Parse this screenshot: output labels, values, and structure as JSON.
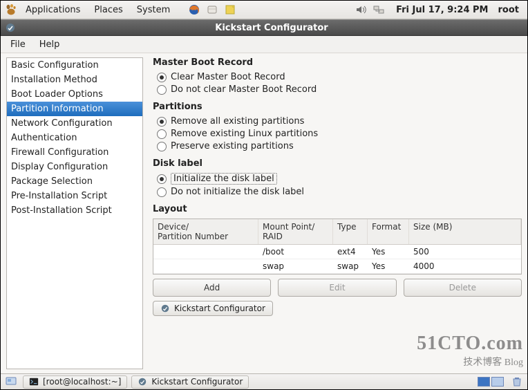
{
  "panel": {
    "menus": [
      "Applications",
      "Places",
      "System"
    ],
    "datetime": "Fri Jul 17,  9:24 PM",
    "user": "root"
  },
  "window": {
    "title": "Kickstart Configurator",
    "menus": [
      "File",
      "Help"
    ]
  },
  "sidebar": {
    "items": [
      "Basic Configuration",
      "Installation Method",
      "Boot Loader Options",
      "Partition Information",
      "Network Configuration",
      "Authentication",
      "Firewall Configuration",
      "Display Configuration",
      "Package Selection",
      "Pre-Installation Script",
      "Post-Installation Script"
    ],
    "selected_index": 3
  },
  "mbr": {
    "title": "Master Boot Record",
    "options": [
      "Clear Master Boot Record",
      "Do not clear Master Boot Record"
    ],
    "selected": 0
  },
  "partitions": {
    "title": "Partitions",
    "options": [
      "Remove all existing partitions",
      "Remove existing Linux partitions",
      "Preserve existing partitions"
    ],
    "selected": 0
  },
  "disklabel": {
    "title": "Disk label",
    "options": [
      "Initialize the disk label",
      "Do not initialize the disk label"
    ],
    "selected": 0,
    "focused": 0
  },
  "layout": {
    "title": "Layout",
    "headers": [
      "Device/\nPartition Number",
      "Mount Point/\nRAID",
      "Type",
      "Format",
      "Size (MB)"
    ],
    "rows": [
      {
        "device": "",
        "mount": "/boot",
        "type": "ext4",
        "format": "Yes",
        "size": "500"
      },
      {
        "device": "",
        "mount": "swap",
        "type": "swap",
        "format": "Yes",
        "size": "4000"
      }
    ],
    "buttons": {
      "add": "Add",
      "edit": "Edit",
      "delete": "Delete"
    }
  },
  "status": {
    "label": "Kickstart Configurator"
  },
  "taskbar": {
    "tasks": [
      {
        "icon": "terminal",
        "label": "[root@localhost:~]"
      },
      {
        "icon": "kickstart",
        "label": "Kickstart Configurator"
      }
    ]
  },
  "watermark": {
    "line1": "51CTO.com",
    "line2": "技术博客     Blog"
  }
}
